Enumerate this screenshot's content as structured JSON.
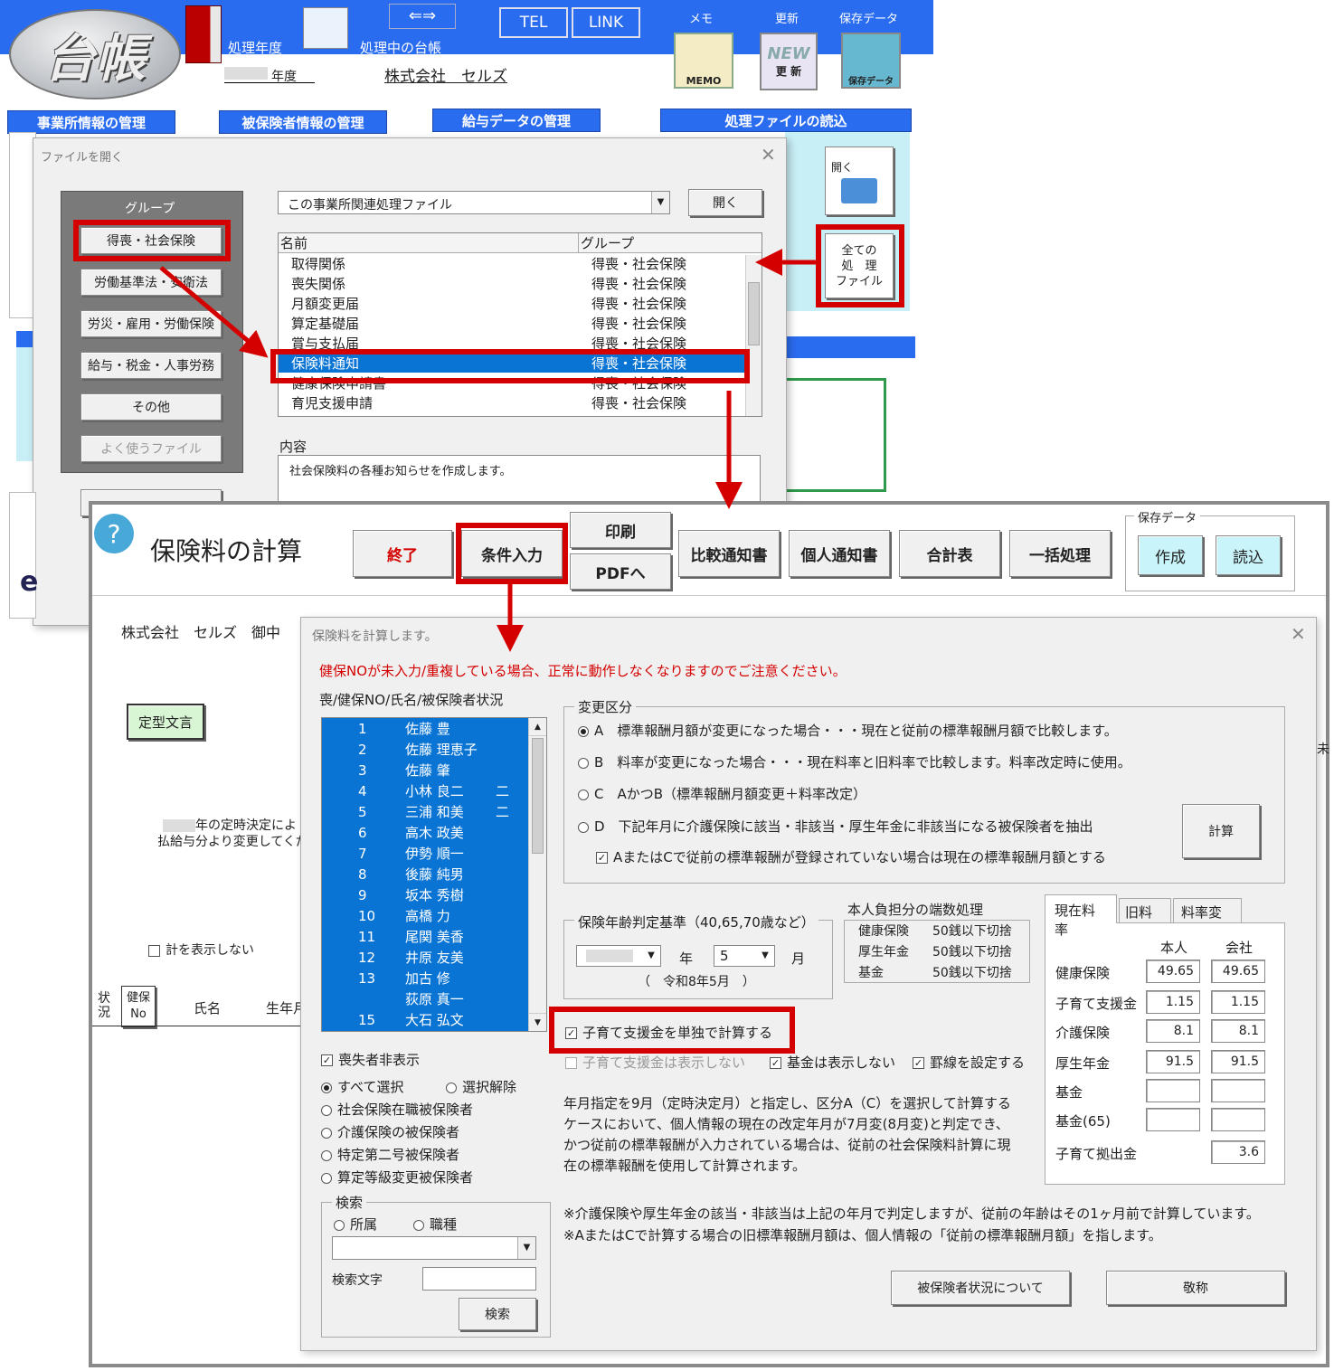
{
  "app": {
    "logo": "台帳",
    "fiscal_year_label": "処理年度",
    "year_suffix": "年度",
    "current_ledger_label": "処理中の台帳",
    "company": "株式会社　セルズ",
    "tel": "TEL",
    "link": "LINK",
    "memo_label": "メモ",
    "memo_icon_text": "MEMO",
    "update_label": "更新",
    "update_icon_text": "更 新",
    "update_new": "NEW",
    "save_label": "保存データ",
    "save_icon_text": "保存データ",
    "tabs": [
      "事業所情報の管理",
      "被保険者情報の管理",
      "給与データの管理",
      "処理ファイルの読込"
    ],
    "open_icon_label": "開く",
    "all_files_button": "全ての\n処　理\nファイル"
  },
  "file_dialog": {
    "title": "ファイルを開く",
    "group_label": "グループ",
    "groups": [
      "得喪・社会保険",
      "労働基準法・安衛法",
      "労災・雇用・労働保険",
      "給与・税金・人事労務",
      "その他",
      "よく使うファイル"
    ],
    "dropdown_value": "この事業所関連処理ファイル",
    "open_button": "開く",
    "col_name": "名前",
    "col_group": "グループ",
    "files": [
      {
        "name": "取得関係",
        "group": "得喪・社会保険"
      },
      {
        "name": "喪失関係",
        "group": "得喪・社会保険"
      },
      {
        "name": "月額変更届",
        "group": "得喪・社会保険"
      },
      {
        "name": "算定基礎届",
        "group": "得喪・社会保険"
      },
      {
        "name": "賞与支払届",
        "group": "得喪・社会保険"
      },
      {
        "name": "保険料通知",
        "group": "得喪・社会保険"
      },
      {
        "name": "健康保険申請書",
        "group": "得喪・社会保険"
      },
      {
        "name": "育児支援申請",
        "group": "得喪・社会保険"
      }
    ],
    "content_label": "内容",
    "content_text": "社会保険料の各種お知らせを作成します。"
  },
  "calc_sheet": {
    "title": "保険料の計算",
    "help": "?",
    "buttons": {
      "exit": "終了",
      "condition": "条件入力",
      "print": "印刷",
      "pdf": "PDFへ",
      "compare": "比較通知書",
      "personal": "個人通知書",
      "total": "合計表",
      "batch": "一括処理"
    },
    "save_group_label": "保存データ",
    "save_create": "作成",
    "save_load": "読込",
    "addressee": "株式会社　セルズ　御中",
    "template_button": "定型文言",
    "bg_text1": "年の定時決定によ",
    "bg_text2": "払給与分より変更してくだ",
    "hide_total": "計を表示しない",
    "hdr_status": "状\n況",
    "hdr_kenpo": "健保\nNo",
    "hdr_name": "氏名",
    "hdr_birth": "生年月"
  },
  "calc_dialog": {
    "title": "保険料を計算します。",
    "warning": "健保NOが未入力/重複している場合、正常に動作しなくなりますのでご注意ください。",
    "list_label": "喪/健保NO/氏名/被保険者状況",
    "people": [
      {
        "no": "1",
        "name": "佐藤 豊",
        "status": ""
      },
      {
        "no": "2",
        "name": "佐藤 理恵子",
        "status": ""
      },
      {
        "no": "3",
        "name": "佐藤 肇",
        "status": ""
      },
      {
        "no": "4",
        "name": "小林 良二",
        "status": "二"
      },
      {
        "no": "5",
        "name": "三浦 和美",
        "status": "二"
      },
      {
        "no": "6",
        "name": "高木 政美",
        "status": ""
      },
      {
        "no": "7",
        "name": "伊勢 順一",
        "status": ""
      },
      {
        "no": "8",
        "name": "後藤 純男",
        "status": ""
      },
      {
        "no": "9",
        "name": "坂本 秀樹",
        "status": ""
      },
      {
        "no": "10",
        "name": "高橋 力",
        "status": ""
      },
      {
        "no": "11",
        "name": "尾関 美香",
        "status": ""
      },
      {
        "no": "12",
        "name": "井原 友美",
        "status": ""
      },
      {
        "no": "13",
        "name": "加古 修",
        "status": ""
      },
      {
        "no": "",
        "name": "荻原 真一",
        "status": ""
      },
      {
        "no": "15",
        "name": "大石 弘文",
        "status": ""
      }
    ],
    "hide_lost": "喪失者非表示",
    "select_all": "すべて選択",
    "deselect": "選択解除",
    "filters": [
      "社会保険在職被保険者",
      "介護保険の被保険者",
      "特定第二号被保険者",
      "算定等級変更被保険者"
    ],
    "search_group": "検索",
    "search_dept": "所属",
    "search_job": "職種",
    "search_text_label": "検索文字",
    "search_button": "検索",
    "change_group": "変更区分",
    "options": [
      "A　標準報酬月額が変更になった場合・・・現在と従前の標準報酬月額で比較します。",
      "B　料率が変更になった場合・・・現在料率と旧料率で比較します。料率改定時に使用。",
      "C　AかつB（標準報酬月額変更＋料率改定）",
      "D　下記年月に介護保険に該当・非該当・厚生年金に非該当になる被保険者を抽出"
    ],
    "option_note": "AまたはCで従前の標準報酬が登録されていない場合は現在の標準報酬月額とする",
    "calc_button": "計算",
    "age_group": "保険年齢判定基準（40,65,70歳など）",
    "year_label": "年",
    "month_value": "5",
    "month_label": "月",
    "era_text": "（　令和8年5月　）",
    "rounding_title": "本人負担分の端数処理",
    "rounding": [
      {
        "label": "健康保険",
        "value": "50銭以下切捨"
      },
      {
        "label": "厚生年金",
        "value": "50銭以下切捨"
      },
      {
        "label": "基金",
        "value": "50銭以下切捨"
      }
    ],
    "child_alone": "子育て支援金を単独で計算する",
    "child_hide": "子育て支援金は表示しない",
    "fund_hide": "基金は表示しない",
    "rule_lines": "罫線を設定する",
    "note": "年月指定を9月（定時決定月）と指定し、区分A（C）を選択して計算するケースにおいて、個人情報の現在の改定年月が7月変(8月変)と判定でき、かつ従前の標準報酬が入力されている場合は、従前の社会保険料計算に現在の標準報酬を使用して計算されます。",
    "footnote1": "※介護保険や厚生年金の該当・非該当は上記の年月で判定しますが、従前の年齢はその1ヶ月前で計算しています。",
    "footnote2": "※AまたはCで計算する場合の旧標準報酬月額は、個人情報の「従前の標準報酬月額」を指します。",
    "rate_tabs": [
      "現在料率",
      "旧料率",
      "料率変更"
    ],
    "rate_col_person": "本人",
    "rate_col_company": "会社",
    "rates": [
      {
        "label": "健康保険",
        "person": "49.65",
        "company": "49.65"
      },
      {
        "label": "子育て支援金",
        "person": "1.15",
        "company": "1.15"
      },
      {
        "label": "介護保険",
        "person": "8.1",
        "company": "8.1"
      },
      {
        "label": "厚生年金",
        "person": "91.5",
        "company": "91.5"
      },
      {
        "label": "基金",
        "person": "",
        "company": ""
      },
      {
        "label": "基金(65)",
        "person": "",
        "company": ""
      },
      {
        "label": "子育て拠出金",
        "person": null,
        "company": "3.6"
      }
    ],
    "status_button": "被保険者状況について",
    "honorific_button": "敬称"
  },
  "colors": {
    "header_blue": "#2a6cf0",
    "highlight_red": "#d40000",
    "selection_blue": "#0a74d4",
    "save_button": "#c8f4fa"
  }
}
